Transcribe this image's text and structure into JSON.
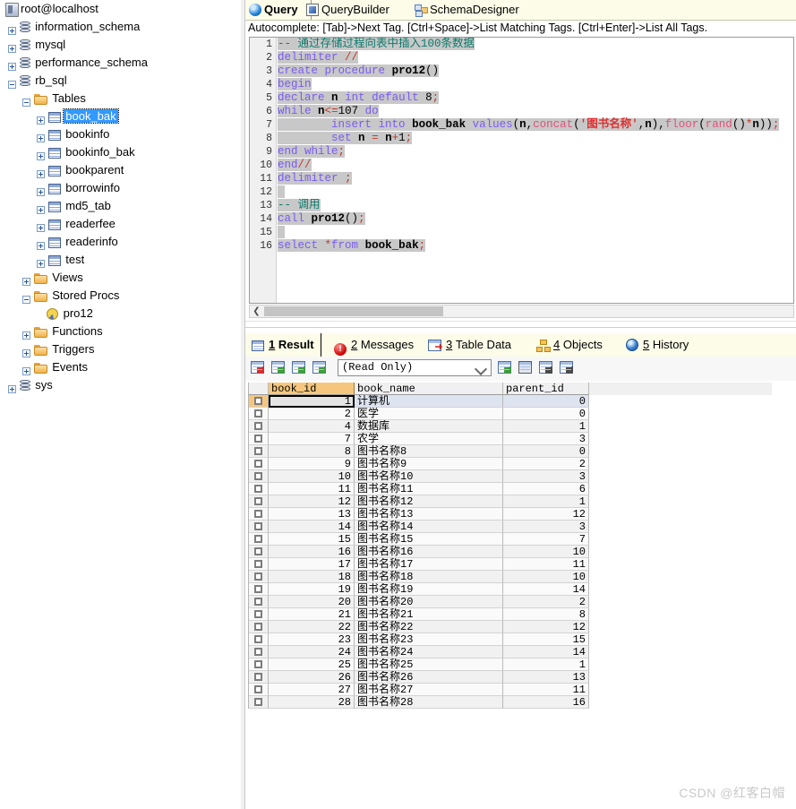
{
  "tree": {
    "root": {
      "label": "root@localhost",
      "icon": "server-icon"
    },
    "items": [
      {
        "label": "information_schema",
        "icon": "database-icon",
        "depth": 1,
        "expander": "plus"
      },
      {
        "label": "mysql",
        "icon": "database-icon",
        "depth": 1,
        "expander": "plus"
      },
      {
        "label": "performance_schema",
        "icon": "database-icon",
        "depth": 1,
        "expander": "plus"
      },
      {
        "label": "rb_sql",
        "icon": "database-icon",
        "depth": 1,
        "expander": "minus"
      },
      {
        "label": "Tables",
        "icon": "folder-icon",
        "depth": 2,
        "expander": "minus"
      },
      {
        "label": "book_bak",
        "icon": "table-icon",
        "depth": 3,
        "expander": "plus",
        "selected": true
      },
      {
        "label": "bookinfo",
        "icon": "table-icon",
        "depth": 3,
        "expander": "plus"
      },
      {
        "label": "bookinfo_bak",
        "icon": "table-icon",
        "depth": 3,
        "expander": "plus"
      },
      {
        "label": "bookparent",
        "icon": "table-icon",
        "depth": 3,
        "expander": "plus"
      },
      {
        "label": "borrowinfo",
        "icon": "table-icon",
        "depth": 3,
        "expander": "plus"
      },
      {
        "label": "md5_tab",
        "icon": "table-icon",
        "depth": 3,
        "expander": "plus"
      },
      {
        "label": "readerfee",
        "icon": "table-icon",
        "depth": 3,
        "expander": "plus"
      },
      {
        "label": "readerinfo",
        "icon": "table-icon",
        "depth": 3,
        "expander": "plus"
      },
      {
        "label": "test",
        "icon": "table-icon",
        "depth": 3,
        "expander": "plus"
      },
      {
        "label": "Views",
        "icon": "folder-icon",
        "depth": 2,
        "expander": "plus"
      },
      {
        "label": "Stored Procs",
        "icon": "folder-icon",
        "depth": 2,
        "expander": "minus"
      },
      {
        "label": "pro12",
        "icon": "procedure-icon",
        "depth": 3,
        "expander": "none"
      },
      {
        "label": "Functions",
        "icon": "folder-icon",
        "depth": 2,
        "expander": "plus"
      },
      {
        "label": "Triggers",
        "icon": "folder-icon",
        "depth": 2,
        "expander": "plus"
      },
      {
        "label": "Events",
        "icon": "folder-icon",
        "depth": 2,
        "expander": "plus"
      },
      {
        "label": "sys",
        "icon": "database-icon",
        "depth": 1,
        "expander": "plus"
      }
    ]
  },
  "top_tabs": [
    {
      "label": "Query",
      "icon": "query-icon",
      "active": true
    },
    {
      "label": "QueryBuilder",
      "icon": "querybuilder-icon",
      "active": false
    },
    {
      "label": "SchemaDesigner",
      "icon": "schemadesigner-icon",
      "active": false
    }
  ],
  "autocomplete_hint": "Autocomplete: [Tab]->Next Tag. [Ctrl+Space]->List Matching Tags. [Ctrl+Enter]->List All Tags.",
  "editor": {
    "line_numbers": [
      "1",
      "2",
      "3",
      "4",
      "5",
      "6",
      "7",
      "8",
      "9",
      "10",
      "11",
      "12",
      "13",
      "14",
      "15",
      "16"
    ],
    "lines": [
      {
        "n": 1,
        "text": "-- 通过存储过程向表中插入100条数据"
      },
      {
        "n": 2,
        "text": "delimiter //"
      },
      {
        "n": 3,
        "text": "create procedure pro12()"
      },
      {
        "n": 4,
        "text": "begin"
      },
      {
        "n": 5,
        "text": "declare n int default 8;"
      },
      {
        "n": 6,
        "text": "while n<=107 do"
      },
      {
        "n": 7,
        "text": "        insert into book_bak values(n,concat('图书名称',n),floor(rand()*n));"
      },
      {
        "n": 8,
        "text": "        set n = n+1;"
      },
      {
        "n": 9,
        "text": "end while;"
      },
      {
        "n": 10,
        "text": "end//"
      },
      {
        "n": 11,
        "text": "delimiter ;"
      },
      {
        "n": 12,
        "text": ""
      },
      {
        "n": 13,
        "text": "-- 调用"
      },
      {
        "n": 14,
        "text": "call pro12();"
      },
      {
        "n": 15,
        "text": ""
      },
      {
        "n": 16,
        "text": "select *from book_bak;"
      }
    ]
  },
  "result_tabs": [
    {
      "num": "1",
      "label": "Result",
      "icon": "result-grid-icon",
      "active": true
    },
    {
      "num": "2",
      "label": "Messages",
      "icon": "messages-info-icon",
      "active": false
    },
    {
      "num": "3",
      "label": "Table Data",
      "icon": "table-data-icon",
      "active": false
    },
    {
      "num": "4",
      "label": "Objects",
      "icon": "objects-icon",
      "active": false
    },
    {
      "num": "5",
      "label": "History",
      "icon": "history-icon",
      "active": false
    }
  ],
  "result_toolbar": {
    "buttons": [
      {
        "name": "grid-view-button",
        "icon": "grid-red-flag-icon"
      },
      {
        "name": "export-grid-button",
        "icon": "grid-green-down-icon"
      },
      {
        "name": "import-grid-button",
        "icon": "grid-green-left-icon"
      },
      {
        "name": "refresh-grid-button",
        "icon": "grid-green-right-icon"
      },
      {
        "name": "add-record-button",
        "icon": "grid-plus-icon"
      },
      {
        "name": "save-record-button",
        "icon": "save-disk-icon"
      },
      {
        "name": "delete-record-button",
        "icon": "grid-delete-icon"
      },
      {
        "name": "edit-record-button",
        "icon": "grid-edit-icon"
      }
    ],
    "mode_select": {
      "value": "(Read Only)"
    }
  },
  "grid": {
    "columns": [
      "book_id",
      "book_name",
      "parent_id"
    ],
    "rows": [
      {
        "book_id": "1",
        "book_name": "计算机",
        "parent_id": "0",
        "selected": true
      },
      {
        "book_id": "2",
        "book_name": "医学",
        "parent_id": "0"
      },
      {
        "book_id": "4",
        "book_name": "数据库",
        "parent_id": "1"
      },
      {
        "book_id": "7",
        "book_name": "农学",
        "parent_id": "3"
      },
      {
        "book_id": "8",
        "book_name": "图书名称8",
        "parent_id": "0"
      },
      {
        "book_id": "9",
        "book_name": "图书名称9",
        "parent_id": "2"
      },
      {
        "book_id": "10",
        "book_name": "图书名称10",
        "parent_id": "3"
      },
      {
        "book_id": "11",
        "book_name": "图书名称11",
        "parent_id": "6"
      },
      {
        "book_id": "12",
        "book_name": "图书名称12",
        "parent_id": "1"
      },
      {
        "book_id": "13",
        "book_name": "图书名称13",
        "parent_id": "12"
      },
      {
        "book_id": "14",
        "book_name": "图书名称14",
        "parent_id": "3"
      },
      {
        "book_id": "15",
        "book_name": "图书名称15",
        "parent_id": "7"
      },
      {
        "book_id": "16",
        "book_name": "图书名称16",
        "parent_id": "10"
      },
      {
        "book_id": "17",
        "book_name": "图书名称17",
        "parent_id": "11"
      },
      {
        "book_id": "18",
        "book_name": "图书名称18",
        "parent_id": "10"
      },
      {
        "book_id": "19",
        "book_name": "图书名称19",
        "parent_id": "14"
      },
      {
        "book_id": "20",
        "book_name": "图书名称20",
        "parent_id": "2"
      },
      {
        "book_id": "21",
        "book_name": "图书名称21",
        "parent_id": "8"
      },
      {
        "book_id": "22",
        "book_name": "图书名称22",
        "parent_id": "12"
      },
      {
        "book_id": "23",
        "book_name": "图书名称23",
        "parent_id": "15"
      },
      {
        "book_id": "24",
        "book_name": "图书名称24",
        "parent_id": "14"
      },
      {
        "book_id": "25",
        "book_name": "图书名称25",
        "parent_id": "1"
      },
      {
        "book_id": "26",
        "book_name": "图书名称26",
        "parent_id": "13"
      },
      {
        "book_id": "27",
        "book_name": "图书名称27",
        "parent_id": "11"
      },
      {
        "book_id": "28",
        "book_name": "图书名称28",
        "parent_id": "16"
      }
    ]
  },
  "watermark": "CSDN @红客白帽",
  "colors": {
    "tab_strip": "#fdfce8",
    "selection_blue": "#3399ff",
    "code_selection_gray": "#c8c8c8",
    "keyword_purple": "#7a5af5",
    "comment_teal": "#0b7a6b",
    "function_pink": "#e0507a",
    "string_red": "#e03030",
    "key_column_orange": "#f5c77e"
  }
}
